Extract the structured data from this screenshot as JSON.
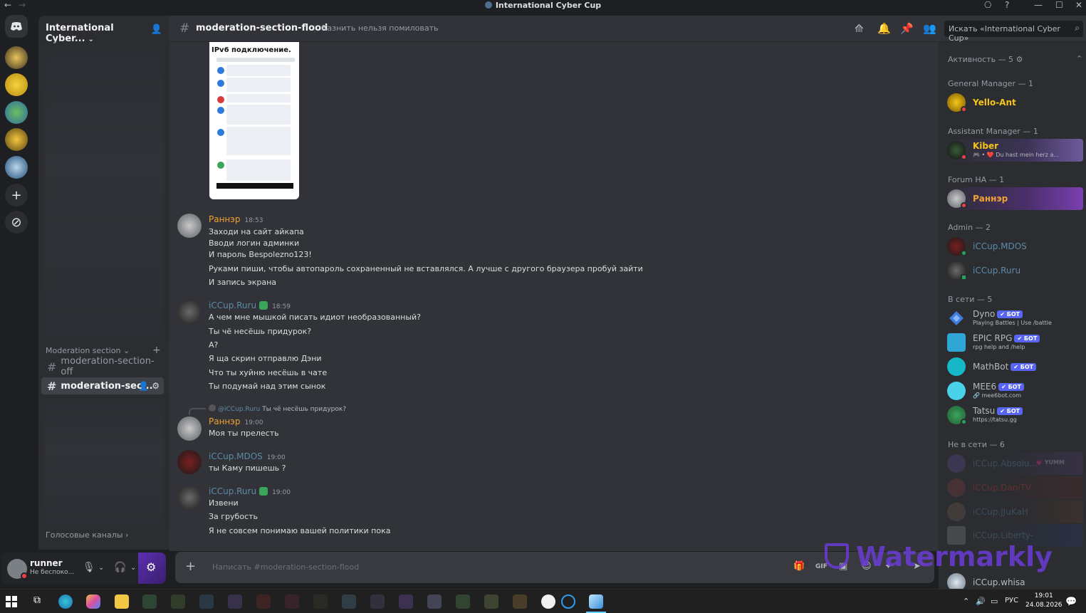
{
  "window": {
    "title": "International Cyber Cup",
    "controls": [
      "⎔",
      "?",
      "—",
      "☐",
      "✕"
    ]
  },
  "guild": {
    "name": "International Cyber...",
    "category_label": "Moderation section",
    "voice_category": "Голосовые каналы",
    "channels": [
      {
        "name": "moderation-section-off",
        "active": false
      },
      {
        "name": "moderation-sec...",
        "active": true
      }
    ]
  },
  "user": {
    "name": "runner",
    "status": "Не беспоко..."
  },
  "header": {
    "channel": "moderation-section-flood",
    "topic": "Казнить нельзя помиловать",
    "search_placeholder": "Искать «International Cyber Cup»"
  },
  "screenshot_preview": {
    "title": "IPv6 подключение."
  },
  "messages": [
    {
      "author": "Раннэр",
      "time": "18:53",
      "color": "#f0a232",
      "lines": [
        "Заходи на сайт айкапа",
        "Вводи логин админки",
        "И пароль Bespolezno123!",
        "Руками пиши, чтобы автопароль сохраненный не вставлялся. А лучше с другого браузера пробуй зайти",
        "И запись экрана"
      ]
    },
    {
      "author": "iCCup.Ruru",
      "time": "18:59",
      "color": "#5c8aa8",
      "lines": [
        "А чем мне мышкой писать идиот необразованный?",
        "Ты чё несёшь придурок?",
        "А?",
        "Я ща скрин отправлю Дэни",
        "Что ты хуйню несёшь в чате",
        "Ты подумай над этим сынок"
      ]
    },
    {
      "author": "Раннэр",
      "time": "19:00",
      "color": "#f0a232",
      "reply": {
        "author": "@iCCup.Ruru",
        "text": "Ты чё несёшь придурок?"
      },
      "lines": [
        "Моя ты прелесть"
      ]
    },
    {
      "author": "iCCup.MDOS",
      "time": "19:00",
      "color": "#5c8aa8",
      "lines": [
        "ты Каму пишешь  ?"
      ]
    },
    {
      "author": "iCCup.Ruru",
      "time": "19:00",
      "color": "#5c8aa8",
      "lines": [
        "Извени",
        "За грубость",
        "Я не совсем понимаю вашей политики пока"
      ]
    }
  ],
  "composer": {
    "placeholder": "Написать #moderation-section-flood"
  },
  "members": {
    "activity_label": "Активность — 5",
    "groups": [
      {
        "title": "General Manager — 1",
        "members": [
          {
            "name": "Yello-Ant",
            "color": "#f5c518",
            "status": "dnd"
          }
        ]
      },
      {
        "title": "Assistant Manager — 1",
        "members": [
          {
            "name": "Kiber",
            "color": "#f5c518",
            "sub": "🎮 • ❤️ Du hast mein herz a...",
            "status": "dnd"
          }
        ]
      },
      {
        "title": "Forum HA — 1",
        "members": [
          {
            "name": "Раннэр",
            "color": "#f0a232",
            "status": "dnd"
          }
        ]
      },
      {
        "title": "Admin — 2",
        "members": [
          {
            "name": "iCCup.MDOS",
            "color": "#5c8aa8",
            "status": "online"
          },
          {
            "name": "iCCup.Ruru",
            "color": "#5c8aa8",
            "status": "mobile"
          }
        ]
      },
      {
        "title": "В сети — 5",
        "members": [
          {
            "name": "Dyno",
            "color": "#b5bac1",
            "bot": "✔ БОТ",
            "sub": "Playing Battles | Use /battle"
          },
          {
            "name": "EPIC RPG",
            "color": "#b5bac1",
            "bot": "✔ БОТ",
            "sub": "rpg help and /help"
          },
          {
            "name": "MathBot",
            "color": "#b5bac1",
            "bot": "✔ БОТ"
          },
          {
            "name": "MEE6",
            "color": "#b5bac1",
            "bot": "✔ БОТ",
            "sub": "🔗 mee6bot.com"
          },
          {
            "name": "Tatsu",
            "color": "#b5bac1",
            "bot": "✔ БОТ",
            "sub": "https://tatsu.gg"
          }
        ]
      },
      {
        "title": "Не в сети — 6",
        "members": [
          {
            "name": "iCCup.Absolu...",
            "color": "#5c8aa8",
            "tag": "💗 YUMM"
          },
          {
            "name": "iCCup.DaniTV",
            "color": "#c0392b"
          },
          {
            "name": "iCCup.JJuKaH",
            "color": "#5c8aa8"
          },
          {
            "name": "iCCup.Liberty-",
            "color": "#5c8aa8"
          },
          {
            "name": "iCCup.whisa",
            "color": "#b5bac1"
          }
        ]
      }
    ]
  },
  "watermark": "Watermarkly",
  "taskbar": {
    "lang": "РУС",
    "time": "19:01",
    "date": "24.08.2026"
  }
}
